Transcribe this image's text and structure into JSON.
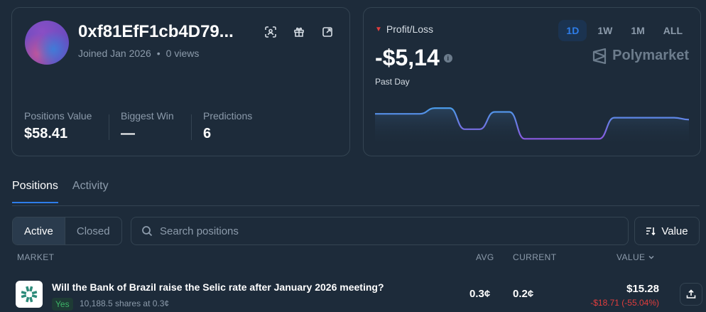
{
  "profile": {
    "handle": "0xf81EfF1cb4D79...",
    "joined": "Joined Jan 2026",
    "separator": "•",
    "views": "0 views",
    "actions": [
      "scan-icon",
      "gift-icon",
      "external-link-icon"
    ],
    "stats": [
      {
        "label": "Positions Value",
        "value": "$58.41"
      },
      {
        "label": "Biggest Win",
        "value": "—"
      },
      {
        "label": "Predictions",
        "value": "6"
      }
    ]
  },
  "pnl": {
    "title": "Profit/Loss",
    "value": "-$5,14",
    "period": "Past Day",
    "ranges": [
      "1D",
      "1W",
      "1M",
      "ALL"
    ],
    "active_range": "1D",
    "brand": "Polymarket",
    "chart_data": {
      "type": "area",
      "values": [
        0.7,
        0.7,
        0.7,
        0.7,
        0.85,
        0.85,
        0.3,
        0.3,
        0.75,
        0.75,
        0.05,
        0.05,
        0.05,
        0.05,
        0.05,
        0.05,
        0.6,
        0.6,
        0.6,
        0.6,
        0.6,
        0.55
      ]
    }
  },
  "tabs": {
    "positions": "Positions",
    "activity": "Activity"
  },
  "filters": {
    "active": "Active",
    "closed": "Closed"
  },
  "search": {
    "placeholder": "Search positions"
  },
  "sort": {
    "label": "Value"
  },
  "table": {
    "headers": {
      "market": "MARKET",
      "avg": "AVG",
      "current": "CURRENT",
      "value": "VALUE"
    },
    "rows": [
      {
        "title": "Will the Bank of Brazil raise the Selic rate after January 2026 meeting?",
        "outcome": "Yes",
        "shares": "10,188.5 shares at 0.3¢",
        "avg": "0.3¢",
        "current": "0.2¢",
        "value": "$15.28",
        "change": "-$18.71 (-55.04%)"
      }
    ]
  },
  "colors": {
    "background": "#1d2b3a",
    "border": "#344452",
    "accent": "#2e7de9",
    "loss": "#e23d3d",
    "gain": "#3db468"
  }
}
